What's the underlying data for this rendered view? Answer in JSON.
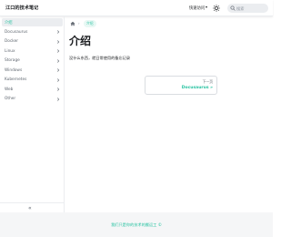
{
  "navbar": {
    "brand": "江口的技术笔记",
    "quick_nav": "快速访问",
    "theme_icon": "sun-icon",
    "search_placeholder": "搜索"
  },
  "sidebar": {
    "items": [
      {
        "label": "介绍",
        "active": true,
        "expandable": false
      },
      {
        "label": "Docusaurus",
        "active": false,
        "expandable": true
      },
      {
        "label": "Docker",
        "active": false,
        "expandable": true
      },
      {
        "label": "Linux",
        "active": false,
        "expandable": true
      },
      {
        "label": "Storage",
        "active": false,
        "expandable": true
      },
      {
        "label": "Windows",
        "active": false,
        "expandable": true
      },
      {
        "label": "Kubernetes",
        "active": false,
        "expandable": true
      },
      {
        "label": "Web",
        "active": false,
        "expandable": true
      },
      {
        "label": "Other",
        "active": false,
        "expandable": true
      }
    ],
    "collapse_symbol": "«"
  },
  "breadcrumb": {
    "home_icon": "home-icon",
    "separator": "›",
    "current": "介绍"
  },
  "main": {
    "title": "介绍",
    "intro": "没什么东西，就日常使用的备忘记录"
  },
  "pager": {
    "sub_label": "下一页",
    "next_title": "Docusaurus »"
  },
  "footer": {
    "text": "我们只是你的技术的搬运工 ©"
  },
  "colors": {
    "accent": "#25c2a0",
    "text": "#1c1e21",
    "muted": "#606770",
    "footer_bg": "#f5f6f7"
  }
}
